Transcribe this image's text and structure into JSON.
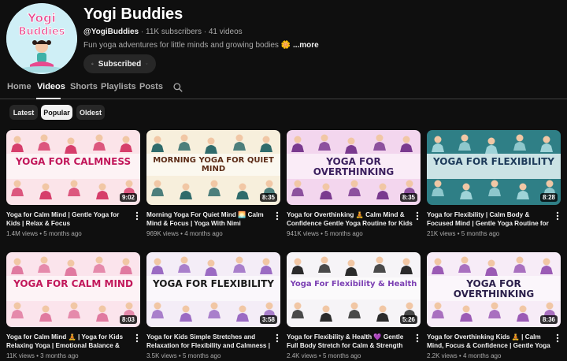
{
  "channel": {
    "name": "Yogi Buddies",
    "avatar_text": [
      "Yogi",
      "Buddies"
    ],
    "handle": "@YogiBuddies",
    "subscribers": "11K subscribers",
    "videos_count": "41 videos",
    "description": "Fun yoga adventures for little minds and growing bodies 🌼",
    "more_label": "...more",
    "subscribe_label": "Subscribed"
  },
  "tabs": [
    {
      "label": "Home"
    },
    {
      "label": "Videos"
    },
    {
      "label": "Shorts"
    },
    {
      "label": "Playlists"
    },
    {
      "label": "Posts"
    }
  ],
  "filters": [
    {
      "label": "Latest"
    },
    {
      "label": "Popular"
    },
    {
      "label": "Oldest"
    }
  ],
  "videos": [
    {
      "thumb_text": "YOGA FOR CALMNESS",
      "duration": "9:02",
      "title": "Yoga for Calm Mind | Gentle Yoga for Kids | Relax & Focus",
      "views": "1.4M views",
      "age": "5 months ago",
      "bg": "#fbe4e9",
      "accent": "#d63e6b",
      "text_color": "#c2185b"
    },
    {
      "thumb_text": "MORNING YOGA FOR QUIET MIND",
      "duration": "8:35",
      "title": "Morning Yoga For Quiet Mind 🌅 Calm Mind & Focus | Yoga With Nimi",
      "views": "969K views",
      "age": "4 months ago",
      "bg": "#f7efdc",
      "accent": "#2f6b6b",
      "text_color": "#5b2b16"
    },
    {
      "thumb_text": "YOGA FOR OVERTHINKING",
      "duration": "8:35",
      "title": "Yoga for Overthinking 🧘 Calm Mind & Confidence Gentle Yoga Routine for Kids",
      "views": "941K views",
      "age": "5 months ago",
      "bg": "#f3d6ee",
      "accent": "#7a3a8f",
      "text_color": "#3b1f5e"
    },
    {
      "thumb_text": "YOGA FOR FLEXIBILITY",
      "duration": "8:28",
      "title": "Yoga for Flexibility | Calm Body & Focused Mind | Gentle Yoga Routine for Kids",
      "views": "21K views",
      "age": "5 months ago",
      "bg": "#2f7f86",
      "accent": "#9fd3d8",
      "text_color": "#1d3b5a"
    },
    {
      "thumb_text": "YOGA FOR CALM MIND",
      "duration": "8:03",
      "title": "Yoga for Calm Mind 🧘 | Yoga for Kids Relaxing Yoga | Emotional Balance & Focus...",
      "views": "11K views",
      "age": "3 months ago",
      "bg": "#fbe4ec",
      "accent": "#e07aa0",
      "text_color": "#c2185b"
    },
    {
      "thumb_text": "YOGA FOR FLEXIBILITY",
      "duration": "3:58",
      "title": "Yoga for Kids Simple Stretches and Relaxation for Flexibility and Calmness | Fu...",
      "views": "3.5K views",
      "age": "5 months ago",
      "bg": "#f4edf7",
      "accent": "#9b6bc3",
      "text_color": "#1a1a1a"
    },
    {
      "thumb_text": "Yoga For Flexibility & Health",
      "duration": "5:26",
      "title": "Yoga for Flexibility & Health 💜 Gentle Full Body Stretch for Calm & Strength",
      "views": "2.4K views",
      "age": "5 months ago",
      "bg": "#f6f4f7",
      "accent": "#2b2b2b",
      "text_color": "#7b3fb3"
    },
    {
      "thumb_text": "YOGA FOR OVERTHINKING",
      "duration": "8:36",
      "title": "Yoga for Overthinking Kids 🧘 | Calm Mind, Focus & Confidence | Gentle Yoga Routine",
      "views": "2.2K views",
      "age": "4 months ago",
      "bg": "#f7ecf7",
      "accent": "#9b5bb5",
      "text_color": "#2b1f4a"
    }
  ]
}
